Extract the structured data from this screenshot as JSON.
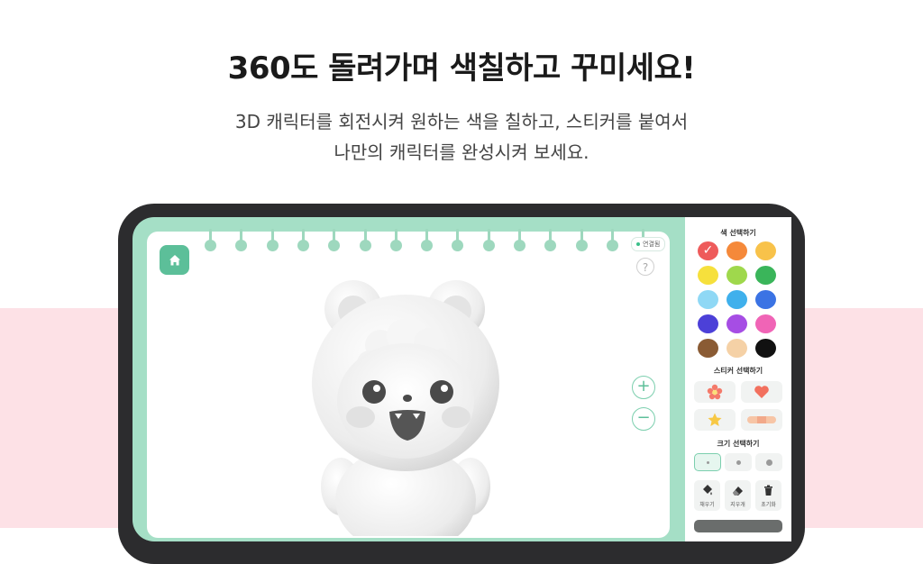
{
  "hero": {
    "title": "360도 돌려가며 색칠하고 꾸미세요!",
    "subtitle_line1": "3D 캐릭터를 회전시켜 원하는 색을 칠하고, 스티커를 붙여서",
    "subtitle_line2": "나만의 캐릭터를 완성시켜 보세요."
  },
  "canvas": {
    "connection_badge": "연결됨",
    "help_label": "?",
    "zoom_in_label": "+",
    "zoom_out_label": "−",
    "home_icon": "home-icon"
  },
  "panel": {
    "color_title": "색 선택하기",
    "colors": [
      {
        "name": "red",
        "hex": "#ee5b5b",
        "selected": true
      },
      {
        "name": "orange",
        "hex": "#f5893a",
        "selected": false
      },
      {
        "name": "amber",
        "hex": "#f8c24a",
        "selected": false
      },
      {
        "name": "yellow",
        "hex": "#f6e03c",
        "selected": false
      },
      {
        "name": "lime",
        "hex": "#9fd84c",
        "selected": false
      },
      {
        "name": "green",
        "hex": "#3ab55a",
        "selected": false
      },
      {
        "name": "sky",
        "hex": "#8fd8f5",
        "selected": false
      },
      {
        "name": "light-blue",
        "hex": "#3fb0ec",
        "selected": false
      },
      {
        "name": "blue",
        "hex": "#3b73e4",
        "selected": false
      },
      {
        "name": "indigo",
        "hex": "#4c40d8",
        "selected": false
      },
      {
        "name": "purple",
        "hex": "#a64de4",
        "selected": false
      },
      {
        "name": "pink",
        "hex": "#f064b6",
        "selected": false
      },
      {
        "name": "brown",
        "hex": "#8a5b34",
        "selected": false
      },
      {
        "name": "beige",
        "hex": "#f5d1a6",
        "selected": false
      },
      {
        "name": "black",
        "hex": "#111111",
        "selected": false
      }
    ],
    "sticker_title": "스티커 선택하기",
    "stickers": [
      "flower-sticker-icon",
      "heart-sticker-icon",
      "star-sticker-icon",
      "bandage-sticker-icon"
    ],
    "size_title": "크기 선택하기",
    "sizes": [
      "small",
      "medium",
      "large"
    ],
    "selected_size": "small",
    "tools": [
      {
        "label": "채우기",
        "icon": "paint-bucket-icon"
      },
      {
        "label": "지우개",
        "icon": "eraser-icon"
      },
      {
        "label": "초기화",
        "icon": "trash-icon"
      }
    ]
  },
  "colors": {
    "frame": "#2c2c2e",
    "mint": "#a5dfc6",
    "accent": "#5cbf99",
    "band": "#fde1e6"
  }
}
